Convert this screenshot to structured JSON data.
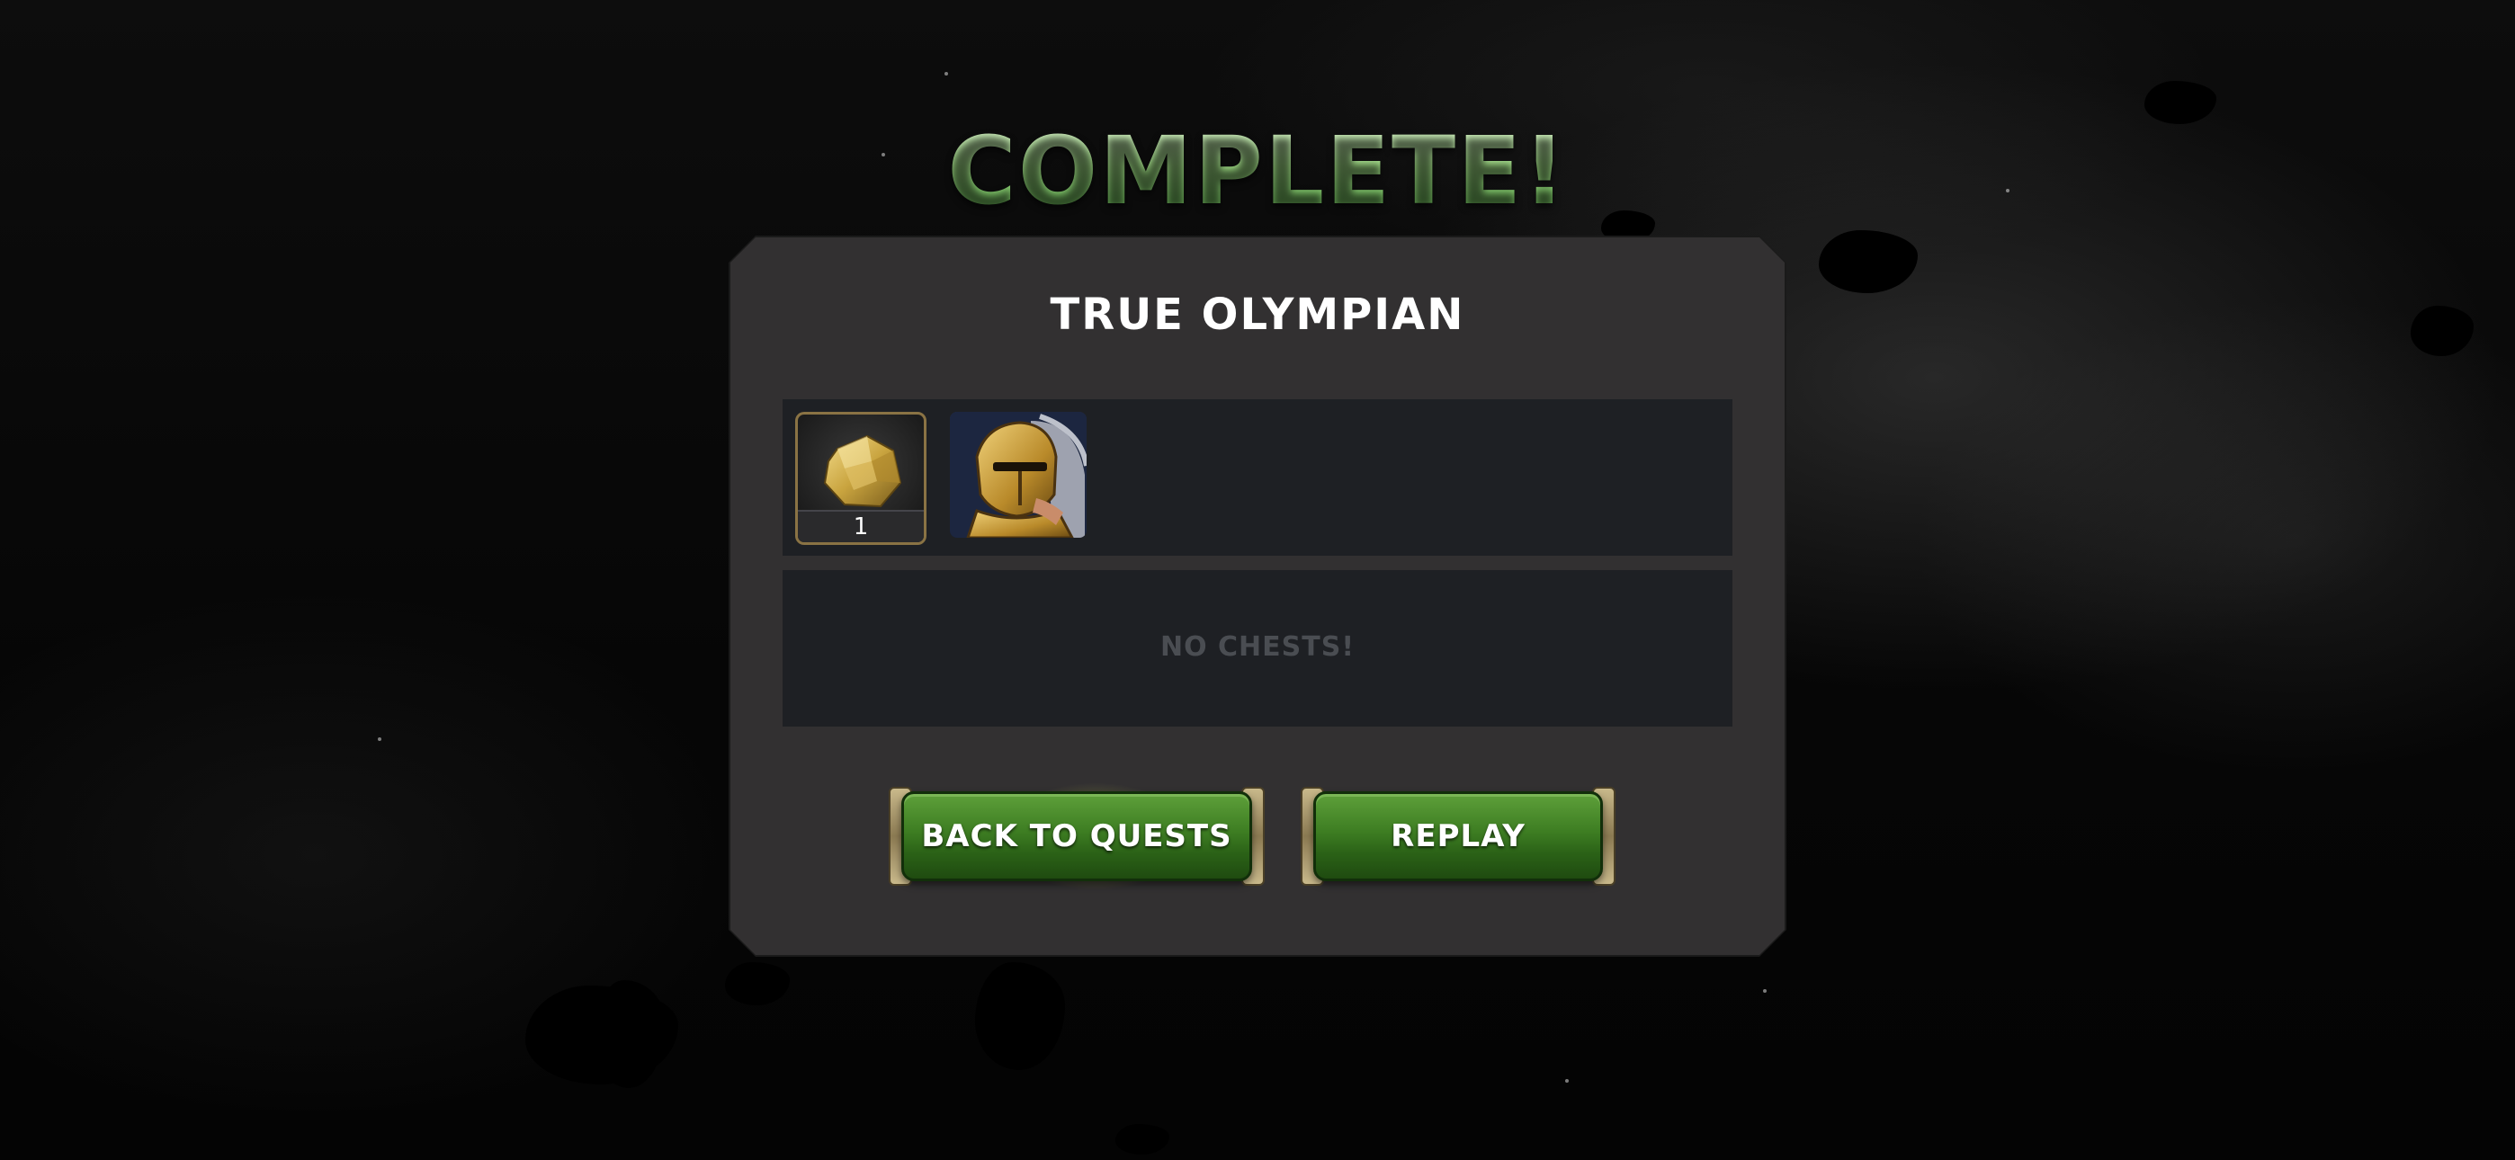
{
  "screen": {
    "title": "COMPLETE!"
  },
  "panel": {
    "quest_name": "TRUE OLYMPIAN",
    "rewards": [
      {
        "icon": "gold-nugget-icon",
        "count": "1"
      },
      {
        "icon": "champion-portrait"
      }
    ],
    "chests_label": "NO CHESTS!"
  },
  "buttons": {
    "back_label": "BACK TO QUESTS",
    "replay_label": "REPLAY"
  },
  "colors": {
    "title_green": "#8fd07a",
    "panel_bg": "#323031",
    "box_bg": "#1e2024",
    "button_green": "#3d7d22",
    "button_trim_gold": "#c9b98b"
  }
}
